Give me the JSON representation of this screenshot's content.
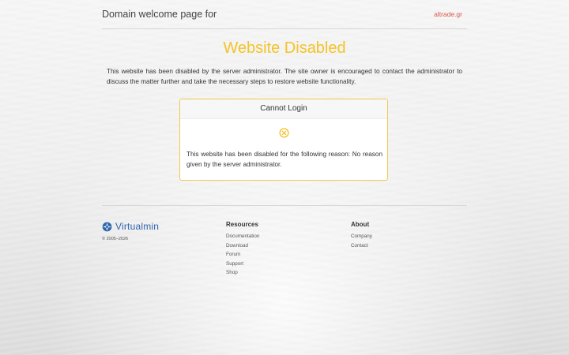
{
  "header": {
    "title": "Domain welcome page for",
    "domain": "altrade.gr"
  },
  "main": {
    "headline": "Website Disabled",
    "intro": "This website has been disabled by the server administrator. The site owner is encouraged to contact the administrator to discuss the matter further and take the necessary steps to restore website functionality."
  },
  "card": {
    "title": "Cannot Login",
    "icon": "circle-x-icon",
    "message": "This website has been disabled for the following reason: No reason given by the server administrator."
  },
  "footer": {
    "brand": "Virtualmin",
    "brand_icon": "virtualmin-logo-icon",
    "copyright": "© 2005–2026",
    "resources": {
      "title": "Resources",
      "links": [
        "Documentation",
        "Download",
        "Forum",
        "Support",
        "Shop"
      ]
    },
    "about": {
      "title": "About",
      "links": [
        "Company",
        "Contact"
      ]
    }
  },
  "colors": {
    "accent": "#f4c328",
    "domain_link": "#d9534f",
    "brand": "#2f64ad"
  }
}
